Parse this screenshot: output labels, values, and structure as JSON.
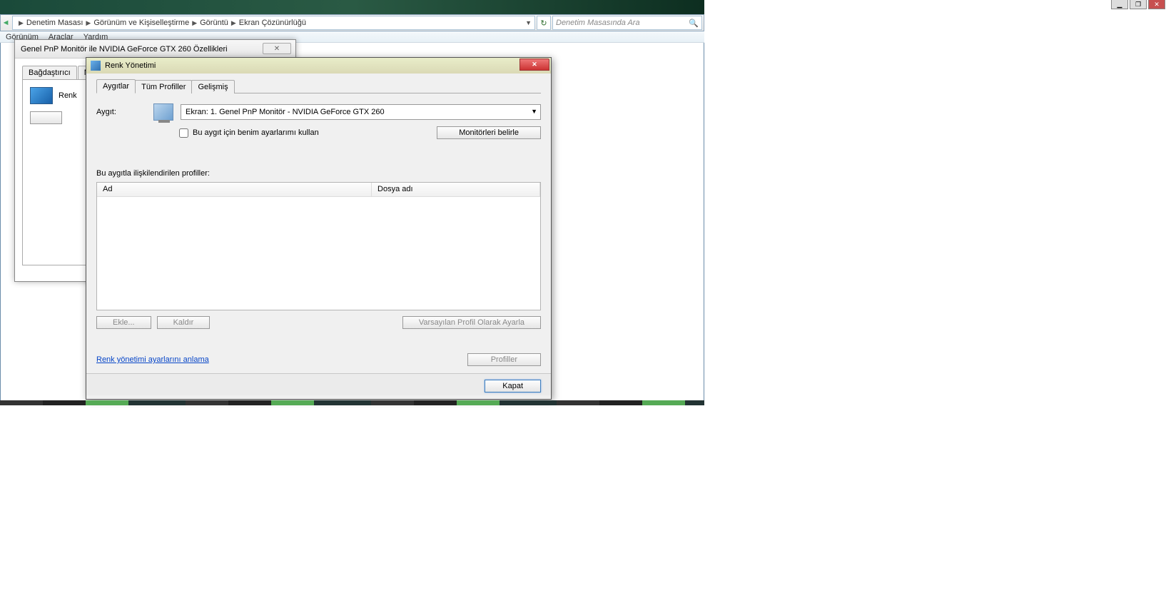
{
  "window_controls": {
    "min": "▁",
    "max": "❐",
    "close": "✕"
  },
  "breadcrumb": {
    "items": [
      "Denetim Masası",
      "Görünüm ve Kişiselleştirme",
      "Görüntü",
      "Ekran Çözünürlüğü"
    ]
  },
  "search": {
    "placeholder": "Denetim Masasında Ara"
  },
  "menubar": {
    "items": [
      "Görünüm",
      "Araçlar",
      "Yardım"
    ]
  },
  "props": {
    "title": "Genel PnP Monitör ile NVIDIA GeForce GTX 260 Özellikleri",
    "tabs": [
      "Bağdaştırıcı",
      "Monitör"
    ],
    "row_label": "Renk"
  },
  "color_mgmt": {
    "title": "Renk Yönetimi",
    "tabs": {
      "devices": "Aygıtlar",
      "all": "Tüm Profiller",
      "advanced": "Gelişmiş"
    },
    "device_label": "Aygıt:",
    "device_value": "Ekran: 1. Genel PnP Monitör - NVIDIA GeForce GTX 260",
    "use_my_settings": "Bu aygıt için benim ayarlarımı kullan",
    "identify": "Monitörleri belirle",
    "profiles_label": "Bu aygıtla ilişkilendirilen profiller:",
    "col_name": "Ad",
    "col_file": "Dosya adı",
    "add": "Ekle...",
    "remove": "Kaldır",
    "set_default": "Varsayılan Profil Olarak Ayarla",
    "profiles_btn": "Profiller",
    "link": "Renk yönetimi ayarlarını anlama",
    "close": "Kapat"
  }
}
